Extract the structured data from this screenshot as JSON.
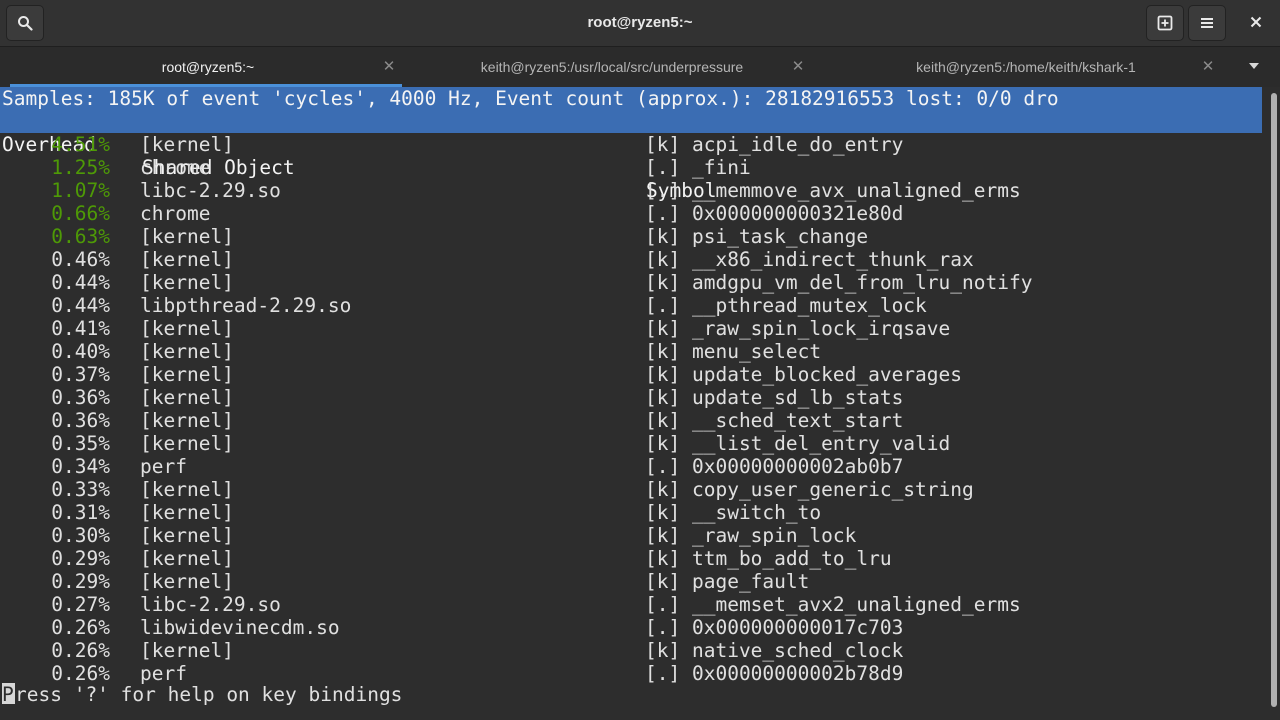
{
  "window": {
    "title": "root@ryzen5:~"
  },
  "tabs": [
    {
      "label": "root@ryzen5:~"
    },
    {
      "label": "keith@ryzen5:/usr/local/src/underpressure"
    },
    {
      "label": "keith@ryzen5:/home/keith/kshark-1"
    }
  ],
  "icons": {
    "search": "search-icon",
    "new_tab": "new-tab-icon",
    "menu": "hamburger-menu-icon",
    "close": "close-icon",
    "tab_close": "close-icon",
    "dropdown": "chevron-down-icon"
  },
  "perf": {
    "samples_line": "Samples: 185K of event 'cycles', 4000 Hz, Event count (approx.): 28182916553 lost: 0/0 dro",
    "columns": {
      "overhead": "Overhead",
      "shared_object": "Shared Object",
      "symbol": "Symbol"
    },
    "rows": [
      {
        "overhead": "4.51%",
        "object": "[kernel]",
        "type": "[k]",
        "symbol": "acpi_idle_do_entry",
        "hot": true
      },
      {
        "overhead": "1.25%",
        "object": "chrome",
        "type": "[.]",
        "symbol": "_fini",
        "hot": true
      },
      {
        "overhead": "1.07%",
        "object": "libc-2.29.so",
        "type": "[.]",
        "symbol": "__memmove_avx_unaligned_erms",
        "hot": true
      },
      {
        "overhead": "0.66%",
        "object": "chrome",
        "type": "[.]",
        "symbol": "0x000000000321e80d",
        "hot": true
      },
      {
        "overhead": "0.63%",
        "object": "[kernel]",
        "type": "[k]",
        "symbol": "psi_task_change",
        "hot": true
      },
      {
        "overhead": "0.46%",
        "object": "[kernel]",
        "type": "[k]",
        "symbol": "__x86_indirect_thunk_rax",
        "hot": false
      },
      {
        "overhead": "0.44%",
        "object": "[kernel]",
        "type": "[k]",
        "symbol": "amdgpu_vm_del_from_lru_notify",
        "hot": false
      },
      {
        "overhead": "0.44%",
        "object": "libpthread-2.29.so",
        "type": "[.]",
        "symbol": "__pthread_mutex_lock",
        "hot": false
      },
      {
        "overhead": "0.41%",
        "object": "[kernel]",
        "type": "[k]",
        "symbol": "_raw_spin_lock_irqsave",
        "hot": false
      },
      {
        "overhead": "0.40%",
        "object": "[kernel]",
        "type": "[k]",
        "symbol": "menu_select",
        "hot": false
      },
      {
        "overhead": "0.37%",
        "object": "[kernel]",
        "type": "[k]",
        "symbol": "update_blocked_averages",
        "hot": false
      },
      {
        "overhead": "0.36%",
        "object": "[kernel]",
        "type": "[k]",
        "symbol": "update_sd_lb_stats",
        "hot": false
      },
      {
        "overhead": "0.36%",
        "object": "[kernel]",
        "type": "[k]",
        "symbol": "__sched_text_start",
        "hot": false
      },
      {
        "overhead": "0.35%",
        "object": "[kernel]",
        "type": "[k]",
        "symbol": "__list_del_entry_valid",
        "hot": false
      },
      {
        "overhead": "0.34%",
        "object": "perf",
        "type": "[.]",
        "symbol": "0x00000000002ab0b7",
        "hot": false
      },
      {
        "overhead": "0.33%",
        "object": "[kernel]",
        "type": "[k]",
        "symbol": "copy_user_generic_string",
        "hot": false
      },
      {
        "overhead": "0.31%",
        "object": "[kernel]",
        "type": "[k]",
        "symbol": "__switch_to",
        "hot": false
      },
      {
        "overhead": "0.30%",
        "object": "[kernel]",
        "type": "[k]",
        "symbol": "_raw_spin_lock",
        "hot": false
      },
      {
        "overhead": "0.29%",
        "object": "[kernel]",
        "type": "[k]",
        "symbol": "ttm_bo_add_to_lru",
        "hot": false
      },
      {
        "overhead": "0.29%",
        "object": "[kernel]",
        "type": "[k]",
        "symbol": "page_fault",
        "hot": false
      },
      {
        "overhead": "0.27%",
        "object": "libc-2.29.so",
        "type": "[.]",
        "symbol": "__memset_avx2_unaligned_erms",
        "hot": false
      },
      {
        "overhead": "0.26%",
        "object": "libwidevinecdm.so",
        "type": "[.]",
        "symbol": "0x000000000017c703",
        "hot": false
      },
      {
        "overhead": "0.26%",
        "object": "[kernel]",
        "type": "[k]",
        "symbol": "native_sched_clock",
        "hot": false
      },
      {
        "overhead": "0.26%",
        "object": "perf",
        "type": "[.]",
        "symbol": "0x00000000002b78d9",
        "hot": false
      }
    ],
    "status": {
      "cursor_char": "P",
      "rest": "ress '?' for help on key bindings"
    }
  },
  "colors": {
    "header_bg": "#3b6db3",
    "hot_overhead": "#4e9a06",
    "tab_indicator": "#4a90d9"
  }
}
